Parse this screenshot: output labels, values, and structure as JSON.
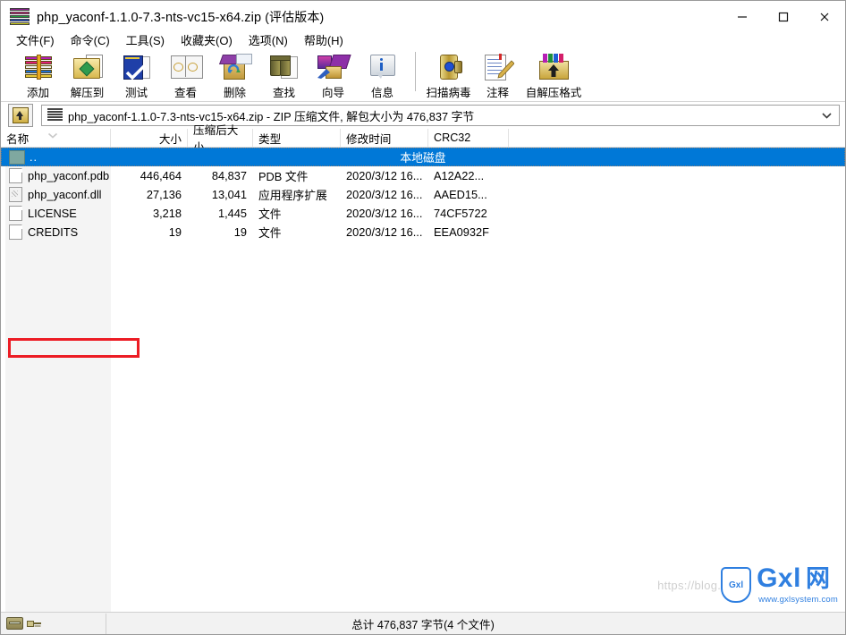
{
  "window": {
    "title_file": "php_yaconf-1.1.0-7.3-nts-vc15-x64.zip",
    "title_suffix": "(评估版本)",
    "minimize_label": "最小化",
    "maximize_label": "最大化",
    "close_label": "关闭"
  },
  "menu": {
    "items": [
      {
        "label": "文件(F)"
      },
      {
        "label": "命令(C)"
      },
      {
        "label": "工具(S)"
      },
      {
        "label": "收藏夹(O)"
      },
      {
        "label": "选项(N)"
      },
      {
        "label": "帮助(H)"
      }
    ]
  },
  "toolbar": {
    "buttons": [
      {
        "label": "添加",
        "icon": "archive-add-icon"
      },
      {
        "label": "解压到",
        "icon": "extract-to-icon"
      },
      {
        "label": "测试",
        "icon": "test-icon"
      },
      {
        "label": "查看",
        "icon": "view-icon"
      },
      {
        "label": "删除",
        "icon": "delete-icon"
      },
      {
        "label": "查找",
        "icon": "find-icon"
      },
      {
        "label": "向导",
        "icon": "wizard-icon"
      },
      {
        "label": "信息",
        "icon": "info-icon"
      },
      {
        "label": "扫描病毒",
        "icon": "virus-scan-icon"
      },
      {
        "label": "注释",
        "icon": "comment-icon"
      },
      {
        "label": "自解压格式",
        "icon": "sfx-icon"
      }
    ]
  },
  "pathbar": {
    "up_button_label": "上一层",
    "text": "php_yaconf-1.1.0-7.3-nts-vc15-x64.zip - ZIP 压缩文件, 解包大小为 476,837 字节",
    "dropdown_icon": "chevron-down-icon"
  },
  "columns": [
    {
      "key": "name",
      "label": "名称"
    },
    {
      "key": "size",
      "label": "大小"
    },
    {
      "key": "packed",
      "label": "压缩后大小"
    },
    {
      "key": "type",
      "label": "类型"
    },
    {
      "key": "date",
      "label": "修改时间"
    },
    {
      "key": "crc",
      "label": "CRC32"
    }
  ],
  "parent_row": {
    "name": "..",
    "center_label": "本地磁盘",
    "selected": true
  },
  "files": [
    {
      "name": "php_yaconf.pdb",
      "size": "446,464",
      "packed": "84,837",
      "type": "PDB 文件",
      "date": "2020/3/12 16...",
      "crc": "A12A22...",
      "icon": "file-icon",
      "highlighted": false
    },
    {
      "name": "php_yaconf.dll",
      "size": "27,136",
      "packed": "13,041",
      "type": "应用程序扩展",
      "date": "2020/3/12 16...",
      "crc": "AAED15...",
      "icon": "dll-icon",
      "highlighted": true
    },
    {
      "name": "LICENSE",
      "size": "3,218",
      "packed": "1,445",
      "type": "文件",
      "date": "2020/3/12 16...",
      "crc": "74CF5722",
      "icon": "file-icon",
      "highlighted": false
    },
    {
      "name": "CREDITS",
      "size": "19",
      "packed": "19",
      "type": "文件",
      "date": "2020/3/12 16...",
      "crc": "EEA0932F",
      "icon": "file-icon",
      "highlighted": false
    }
  ],
  "statusbar": {
    "disk_icon": "disk-icon",
    "key_icon": "key-icon",
    "total_text": "总计 476,837 字节(4 个文件)"
  },
  "watermark": {
    "url_faint": "https://blog.c",
    "shield_text": "Gxl",
    "brand": "Gxl",
    "brand_cn": "网",
    "site": "www.gxlsystem.com"
  },
  "colors": {
    "selection": "#0078d7",
    "annotation": "#ec1c24",
    "watermark": "#2f7fe0"
  }
}
